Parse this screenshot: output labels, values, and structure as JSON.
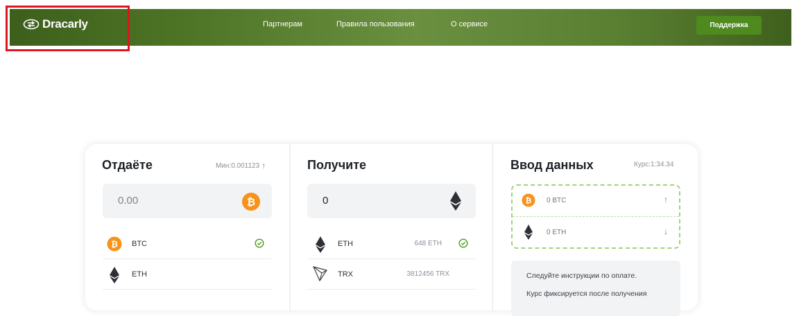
{
  "header": {
    "logo_text": "Dracarly",
    "nav": [
      "Партнерам",
      "Правила пользования",
      "О сервисе"
    ],
    "support_label": "Поддержка"
  },
  "give": {
    "title": "Отдаёте",
    "min_label": "Мин:0.001123",
    "amount": "0.00",
    "items": [
      {
        "label": "BTC",
        "selected": true
      },
      {
        "label": "ETH",
        "selected": false
      }
    ]
  },
  "receive": {
    "title": "Получите",
    "amount": "0",
    "items": [
      {
        "label": "ETH",
        "reserve": "648 ETH",
        "selected": true
      },
      {
        "label": "TRX",
        "reserve": "3812456 TRX",
        "selected": false
      }
    ]
  },
  "input_data": {
    "title": "Ввод данных",
    "rate_label": "Курс:1:34.34",
    "send_value": "0 BTC",
    "receive_value": "0 ETH",
    "instruction_1": "Следуйте инструкции по оплате.",
    "instruction_2": "Курс фиксируется после получения"
  },
  "colors": {
    "brand_green": "#4e8a1e",
    "accent_green": "#4a9d1e",
    "btc_orange": "#f7931a",
    "highlight_red": "#e0141c"
  },
  "icons": [
    "exchange-logo-icon",
    "bitcoin-icon",
    "ethereum-icon",
    "tron-icon",
    "check-circle-icon",
    "arrow-up-icon",
    "arrow-down-icon"
  ]
}
